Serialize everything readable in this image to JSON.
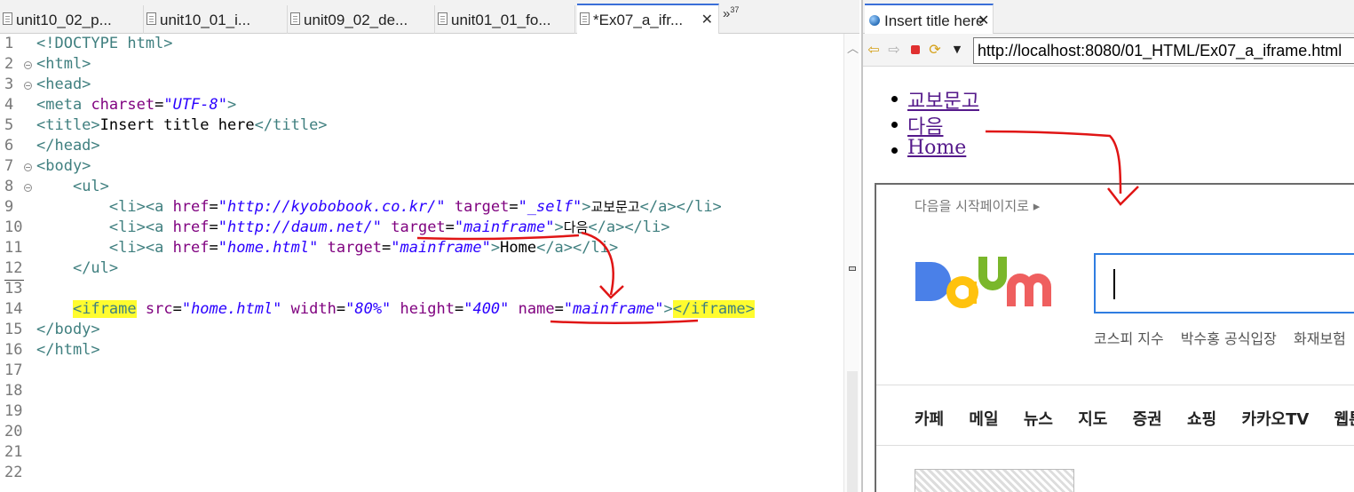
{
  "editor": {
    "tabs": [
      {
        "label": "unit10_02_p..."
      },
      {
        "label": "unit10_01_i..."
      },
      {
        "label": "unit09_02_de..."
      },
      {
        "label": "unit01_01_fo..."
      },
      {
        "label": "*Ex07_a_ifr..."
      }
    ],
    "overflow_label": "»",
    "overflow_count": "37",
    "close_glyph": "✕",
    "line_numbers": [
      "1",
      "2",
      "3",
      "4",
      "5",
      "6",
      "7",
      "8",
      "9",
      "10",
      "11",
      "12",
      "13",
      "14",
      "15",
      "16",
      "17",
      "18",
      "19",
      "20",
      "21",
      "22"
    ],
    "code": {
      "l1": {
        "tag": "<!DOCTYPE html>"
      },
      "l2": {
        "tag": "<html>"
      },
      "l3": {
        "tag": "<head>"
      },
      "l4": {
        "tag_open": "<meta",
        "attr": "charset",
        "eq": "=",
        "value": "\"UTF-8\"",
        "tag_close": ">"
      },
      "l5": {
        "tag_open": "<title>",
        "text": "Insert title here",
        "tag_close": "</title>"
      },
      "l6": {
        "tag": "</head>"
      },
      "l7": {
        "tag": "<body>"
      },
      "l8": {
        "indent": "    ",
        "tag": "<ul>"
      },
      "l9": {
        "indent": "        ",
        "t1": "<li><a",
        "a1": "href",
        "v1": "\"http://kyobobook.co.kr/\"",
        "a2": "target",
        "v2": "\"_self\"",
        "t2": ">",
        "text": "교보문고",
        "t3": "</a></li>"
      },
      "l10": {
        "indent": "        ",
        "t1": "<li><a",
        "a1": "href",
        "v1": "\"http://daum.net/\"",
        "a2": "target",
        "v2": "\"mainframe\"",
        "t2": ">",
        "text": "다음",
        "t3": "</a></li>"
      },
      "l11": {
        "indent": "        ",
        "t1": "<li><a",
        "a1": "href",
        "v1": "\"home.html\"",
        "a2": "target",
        "v2": "\"mainframe\"",
        "t2": ">",
        "text": "Home",
        "t3": "</a></li>"
      },
      "l12": {
        "indent": "    ",
        "tag": "</ul>"
      },
      "l14": {
        "indent": "    ",
        "t1": "<iframe",
        "a1": "src",
        "v1": "\"home.html\"",
        "a2": "width",
        "v2": "\"80%\"",
        "a3": "height",
        "v3": "\"400\"",
        "a4": "name",
        "v4": "\"mainframe\"",
        "t2": ">",
        "t3": "</iframe>"
      },
      "l15": {
        "tag": "</body>"
      },
      "l16": {
        "tag": "</html>"
      }
    }
  },
  "browser": {
    "tab_title": "Insert title here",
    "close_glyph": "✕",
    "address": "http://localhost:8080/01_HTML/Ex07_a_iframe.html",
    "links": [
      {
        "label": "교보문고"
      },
      {
        "label": "다음"
      },
      {
        "label": "Home"
      }
    ],
    "iframe": {
      "startpage_label": "다음을 시작페이지로 ▸",
      "keywords": [
        "코스피 지수",
        "박수홍 공식입장",
        "화재보험"
      ],
      "nav": [
        "카페",
        "메일",
        "뉴스",
        "지도",
        "증권",
        "쇼핑",
        "카카오TV",
        "웹툰"
      ]
    }
  },
  "colors": {
    "tag": "#3f7f7f",
    "attribute": "#7f007f",
    "value": "#2a00ff",
    "highlight": "#fffc2f",
    "annotation": "#e01515",
    "link": "#551a8b",
    "search_border": "#2f7de1"
  },
  "icons": [
    "file-icon",
    "globe-icon",
    "back-icon",
    "forward-icon",
    "stop-icon",
    "refresh-icon",
    "dropdown-icon",
    "daum-logo"
  ]
}
